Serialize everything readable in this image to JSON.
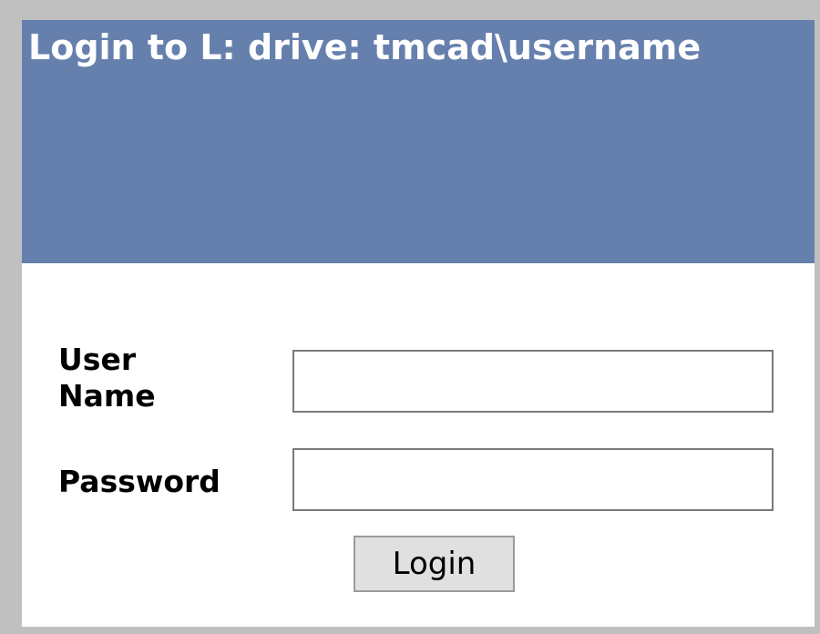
{
  "header": {
    "title": "Login to L: drive: tmcad\\username"
  },
  "form": {
    "username_label": "User Name",
    "username_value": "",
    "password_label": "Password",
    "password_value": "",
    "login_label": "Login"
  },
  "colors": {
    "header_bg": "#6680ae",
    "page_border": "#c0c0c0",
    "panel_bg": "#ffffff"
  }
}
